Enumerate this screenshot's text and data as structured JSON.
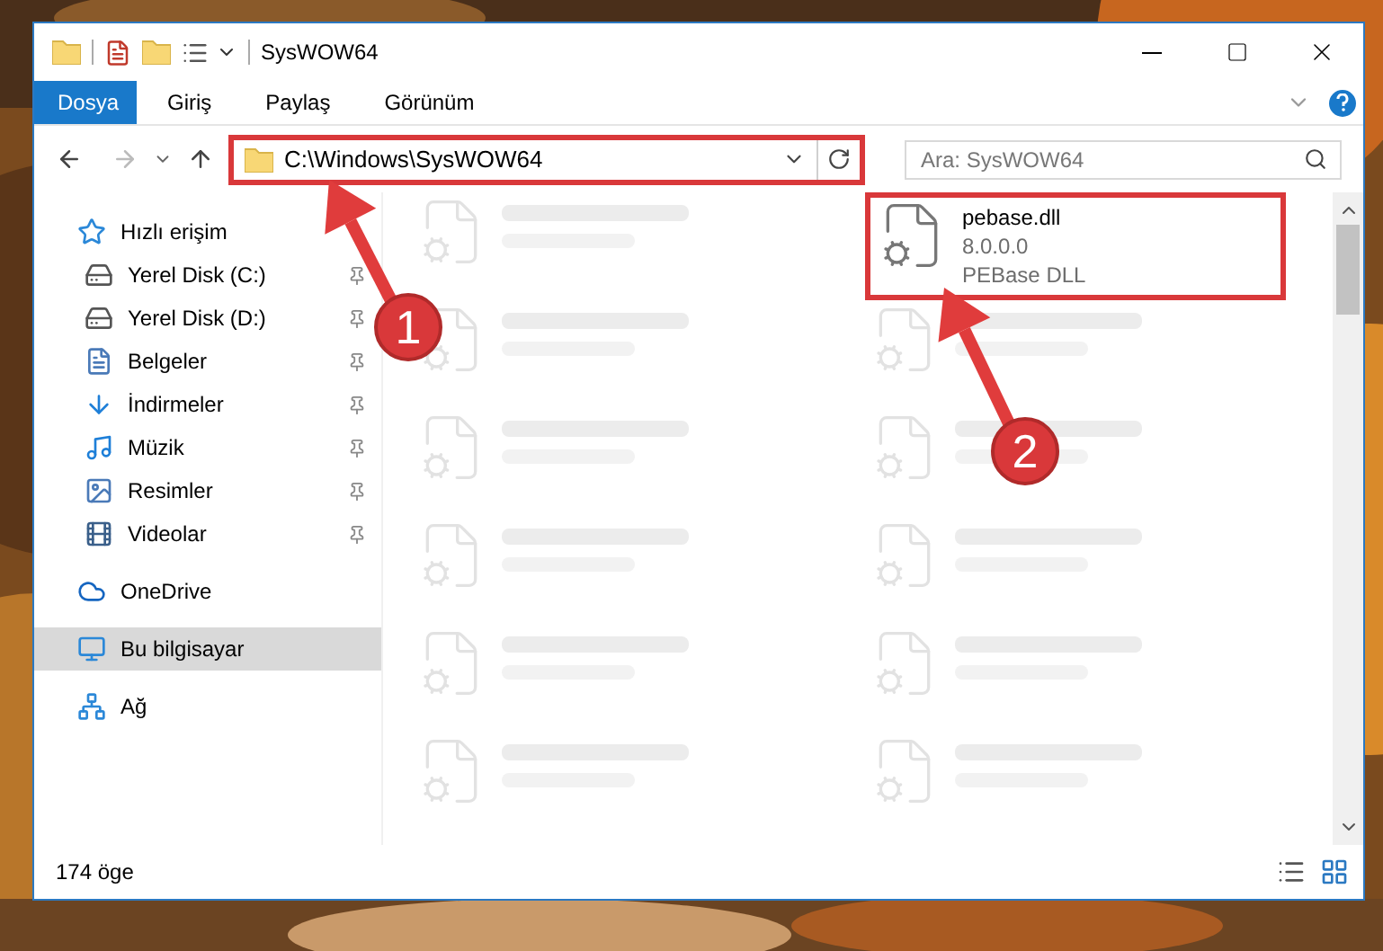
{
  "window": {
    "title": "SysWOW64"
  },
  "ribbon_tabs": [
    {
      "label": "Dosya",
      "selected": true
    },
    {
      "label": "Giriş",
      "selected": false
    },
    {
      "label": "Paylaş",
      "selected": false
    },
    {
      "label": "Görünüm",
      "selected": false
    }
  ],
  "address": {
    "path": "C:\\Windows\\SysWOW64",
    "highlighted": true
  },
  "search": {
    "placeholder": "Ara: SysWOW64"
  },
  "sidebar": {
    "items": [
      {
        "label": "Hızlı erişim",
        "kind": "star",
        "selected": false,
        "children": [
          {
            "label": "Yerel Disk (C:)",
            "kind": "drive",
            "pinned": true,
            "selected": false
          },
          {
            "label": "Yerel Disk (D:)",
            "kind": "drive",
            "pinned": true,
            "selected": false
          },
          {
            "label": "Belgeler",
            "kind": "docs",
            "pinned": true,
            "selected": false
          },
          {
            "label": "İndirmeler",
            "kind": "download",
            "pinned": true,
            "selected": false
          },
          {
            "label": "Müzik",
            "kind": "music",
            "pinned": true,
            "selected": false
          },
          {
            "label": "Resimler",
            "kind": "pictures",
            "pinned": true,
            "selected": false
          },
          {
            "label": "Videolar",
            "kind": "videos",
            "pinned": true,
            "selected": false
          }
        ]
      },
      {
        "label": "OneDrive",
        "kind": "cloud",
        "selected": false
      },
      {
        "label": "Bu bilgisayar",
        "kind": "computer",
        "selected": true
      },
      {
        "label": "Ağ",
        "kind": "network",
        "selected": false
      }
    ]
  },
  "files": [
    {
      "kind": "blurred"
    },
    {
      "kind": "file",
      "name": "pebase.dll",
      "details": [
        "8.0.0.0",
        "PEBase DLL"
      ],
      "highlighted": true
    },
    {
      "kind": "blurred"
    },
    {
      "kind": "blurred"
    },
    {
      "kind": "blurred"
    },
    {
      "kind": "blurred"
    },
    {
      "kind": "blurred"
    },
    {
      "kind": "blurred"
    },
    {
      "kind": "blurred"
    },
    {
      "kind": "blurred"
    },
    {
      "kind": "blurred"
    },
    {
      "kind": "blurred"
    }
  ],
  "status_bar": {
    "count": "174 öge"
  },
  "annotations": [
    {
      "label": "1"
    },
    {
      "label": "2"
    }
  ]
}
